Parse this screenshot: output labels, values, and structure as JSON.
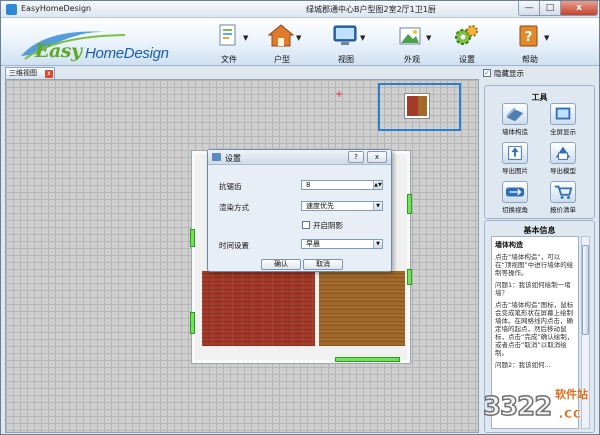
{
  "window": {
    "title": "EasyHomeDesign",
    "document_title": "绿城郡通中心B户型图2室2厅1卫1厨",
    "min": "—",
    "max": "□",
    "close": "x"
  },
  "logo": {
    "easy": "Easy",
    "home": "HomeDesign"
  },
  "menus": [
    {
      "label": "文件",
      "icon": "file-icon"
    },
    {
      "label": "户型",
      "icon": "house-icon"
    },
    {
      "label": "视图",
      "icon": "monitor-icon"
    },
    {
      "label": "外观",
      "icon": "picture-icon"
    },
    {
      "label": "设置",
      "icon": "gear-icon"
    },
    {
      "label": "帮助",
      "icon": "help-book-icon"
    }
  ],
  "tab": {
    "label": "三维视图",
    "close": "x"
  },
  "dialog": {
    "title": "设置",
    "help": "?",
    "close": "x",
    "fields": {
      "aa_label": "抗锯齿",
      "aa_value": "8",
      "render_label": "渲染方式",
      "render_value": "速度优先",
      "shadow_label": "开启阴影",
      "time_label": "时间设置",
      "time_value": "早晨"
    },
    "ok": "确认",
    "cancel": "取消"
  },
  "right_panel": {
    "show_hide": "隐藏显示",
    "tools_title": "工具",
    "tools": [
      {
        "label": "墙体构造",
        "icon": "wall-build-icon"
      },
      {
        "label": "全屏显示",
        "icon": "fullscreen-icon"
      },
      {
        "label": "导出图片",
        "icon": "export-image-icon"
      },
      {
        "label": "导出模型",
        "icon": "export-model-icon"
      },
      {
        "label": "切换视角",
        "icon": "switch-view-icon"
      },
      {
        "label": "报价清单",
        "icon": "cart-icon"
      }
    ],
    "info_title": "基本信息",
    "info": {
      "heading": "墙体构造",
      "p1": "点击“墙体构造”，可以在“顶视图”中进行墙体的绘制等操作。",
      "p2": "问题1：我该如何绘制一堵墙？",
      "p3": "点击“墙体构造”图标，鼠标会变成笔形状在屏幕上绘制墙体。在网格线内点击，确定墙的起点，然后移动鼠标，点击“完成”确认绘制，或者点击“取消”以取消绘制。",
      "p4": "问题2：我该如何..."
    }
  },
  "watermark": {
    "number": "3322",
    "suffix": ".cc",
    "site": "软件站"
  },
  "colors": {
    "ribbon_top": "#ffffff",
    "ribbon_bottom": "#cfe0f1",
    "floor_red": "#a43a28",
    "floor_wood": "#a2692a",
    "door_green": "#72e25b",
    "selection_blue": "#2b7fd3"
  }
}
